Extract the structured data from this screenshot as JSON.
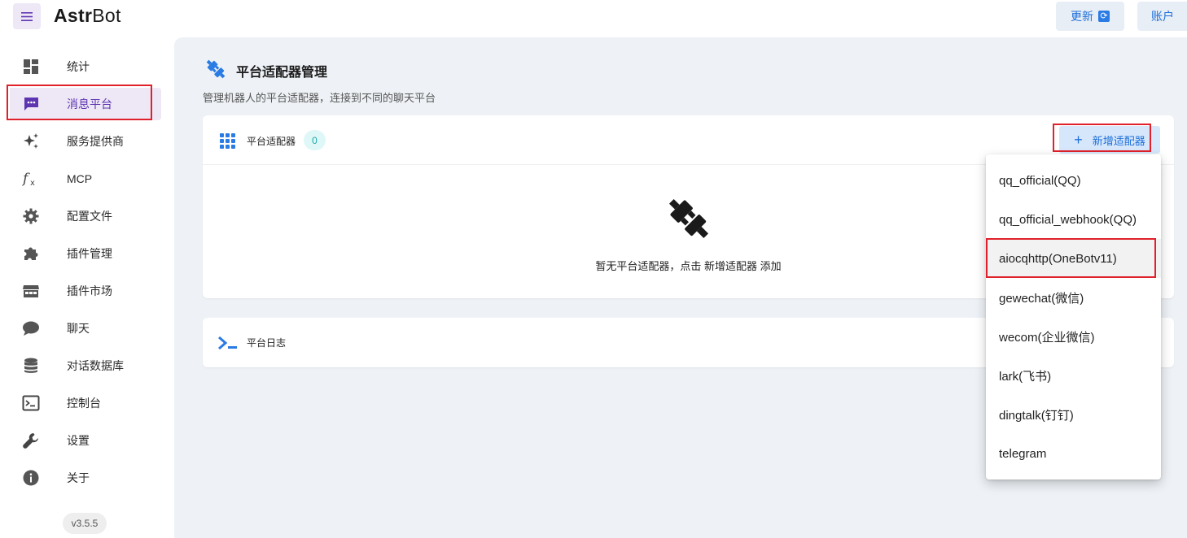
{
  "app": {
    "brand_bold": "Astr",
    "brand_light": "Bot"
  },
  "header": {
    "update_label": "更新",
    "account_label": "账户"
  },
  "sidebar": {
    "items": [
      {
        "label": "统计",
        "icon": "dashboard-icon"
      },
      {
        "label": "消息平台",
        "icon": "message-icon",
        "active": true
      },
      {
        "label": "服务提供商",
        "icon": "sparkle-icon"
      },
      {
        "label": "MCP",
        "icon": "function-icon"
      },
      {
        "label": "配置文件",
        "icon": "gear-icon"
      },
      {
        "label": "插件管理",
        "icon": "puzzle-icon"
      },
      {
        "label": "插件市场",
        "icon": "store-icon"
      },
      {
        "label": "聊天",
        "icon": "chat-icon"
      },
      {
        "label": "对话数据库",
        "icon": "database-icon"
      },
      {
        "label": "控制台",
        "icon": "console-icon"
      },
      {
        "label": "设置",
        "icon": "wrench-icon"
      },
      {
        "label": "关于",
        "icon": "info-icon"
      }
    ],
    "version": "v3.5.5"
  },
  "page": {
    "title": "平台适配器管理",
    "subtitle": "管理机器人的平台适配器，连接到不同的聊天平台"
  },
  "adapters_card": {
    "title": "平台适配器",
    "count": "0",
    "add_button": "新增适配器",
    "empty_text": "暂无平台适配器，点击 新增适配器 添加"
  },
  "logs_card": {
    "title": "平台日志"
  },
  "dropdown": {
    "options": [
      "qq_official(QQ)",
      "qq_official_webhook(QQ)",
      "aiocqhttp(OneBotv11)",
      "gewechat(微信)",
      "wecom(企业微信)",
      "lark(飞书)",
      "dingtalk(钉钉)",
      "telegram"
    ]
  },
  "colors": {
    "accent": "#5e35b1",
    "primary": "#1e6fd9",
    "highlight": "#e0202a",
    "background": "#eef2f6"
  }
}
